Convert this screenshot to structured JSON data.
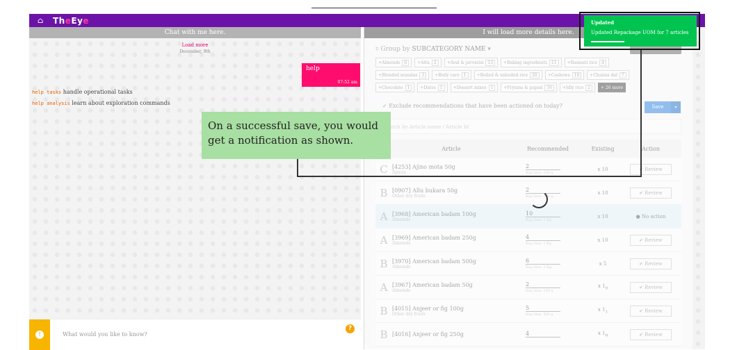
{
  "app": {
    "logo_prefix": "Th",
    "logo_e": "e",
    "logo_suffix": "Ey",
    "logo_e2": "e"
  },
  "chat": {
    "header": "Chat with me here.",
    "load_more": "Load more",
    "date": "December, 9th",
    "user_msg": "help",
    "user_time": "07:52 am",
    "commands": [
      {
        "cmd": "help tasks",
        "desc": "handle operational tasks"
      },
      {
        "cmd": "help analysis",
        "desc": "learn about exploration commands"
      }
    ],
    "input_placeholder": "What would you like to know?",
    "help_icon": "?"
  },
  "details": {
    "header": "I will load more details here.",
    "group_by": "Group by",
    "group_field": "SUBCATEGORY NAME",
    "chips": [
      [
        {
          "l": "Almonds",
          "c": "6"
        },
        {
          "l": "Atta",
          "c": "2"
        },
        {
          "l": "Aval & javvarisi",
          "c": "13"
        },
        {
          "l": "Baking ingredients",
          "c": "11"
        },
        {
          "l": "Basmati rice",
          "c": "4"
        }
      ],
      [
        {
          "l": "Blended masalas",
          "c": "3"
        },
        {
          "l": "Body care",
          "c": "1"
        },
        {
          "l": "Boiled & unboiled rice",
          "c": "20"
        },
        {
          "l": "Cashews",
          "c": "18"
        },
        {
          "l": "Channa dal",
          "c": "7"
        }
      ],
      [
        {
          "l": "Chocolate",
          "c": "1"
        },
        {
          "l": "Dates",
          "c": "1"
        },
        {
          "l": "Dessert mixes",
          "c": "1"
        },
        {
          "l": "Fryums & papad",
          "c": "16"
        },
        {
          "l": "Idly rice",
          "c": "2"
        }
      ]
    ],
    "more_chip": "+ 26 more",
    "exclude_text": "Exclude recommendations that have been actioned on today?",
    "save_label": "Save",
    "search_placeholder": "Search by Article name / Article Id",
    "columns": [
      "Article",
      "Recommended",
      "Existing",
      "Action"
    ],
    "rows": [
      {
        "cls": "C",
        "name": "[4253] Ajino mota 50g",
        "sub": "Spices",
        "rec": "2",
        "recsub": "Bag Size: 100 g",
        "ex": "x 10",
        "action": "Review"
      },
      {
        "cls": "B",
        "name": "[0907] Allu bukara 50g",
        "sub": "Other dry fruits",
        "rec": "2",
        "recsub": "Bag Size: 100 g",
        "ex": "x 10",
        "action": "Review"
      },
      {
        "cls": "A",
        "name": "[3968] American badam 100g",
        "sub": "Almonds",
        "rec": "10",
        "recsub": "Bag Size: 1 Kg",
        "ex": "x 10",
        "action": "No action"
      },
      {
        "cls": "A",
        "name": "[3969] American badam 250g",
        "sub": "Almonds",
        "rec": "4",
        "recsub": "Bag Size: 1 Kg",
        "ex": "x 10",
        "action": "Review"
      },
      {
        "cls": "B",
        "name": "[3970] American badam 500g",
        "sub": "Almonds",
        "rec": "6",
        "recsub": "Bag Size: 3 Kg",
        "ex": "x 5",
        "action": "Review"
      },
      {
        "cls": "A",
        "name": "[3967] American badam 50g",
        "sub": "Almonds",
        "rec": "2",
        "recsub": "Bag Size: 100 g",
        "ex": "x 1",
        "ex2": "0",
        "action": "Review"
      },
      {
        "cls": "B",
        "name": "[4015] Anjeer or fig 100g",
        "sub": "Other dry fruits",
        "rec": "5",
        "recsub": "Bag Size: 500 g",
        "ex": "x 1",
        "ex2": "1",
        "action": "Review"
      },
      {
        "cls": "B",
        "name": "[4016] Anjeer or fig 250g",
        "sub": "",
        "rec": "4",
        "recsub": "",
        "ex": "x 1",
        "ex2": "0",
        "action": "Review"
      }
    ]
  },
  "callout": "On a successful save, you would get a notification as shown.",
  "toast": {
    "title": "Updated",
    "message": "Updated Repackage UOM for 7 articles"
  },
  "colors": {
    "nav": "#6b13a8",
    "accent": "#ff0d6e",
    "toast": "#00c44f",
    "callout": "#a8dfa2"
  }
}
